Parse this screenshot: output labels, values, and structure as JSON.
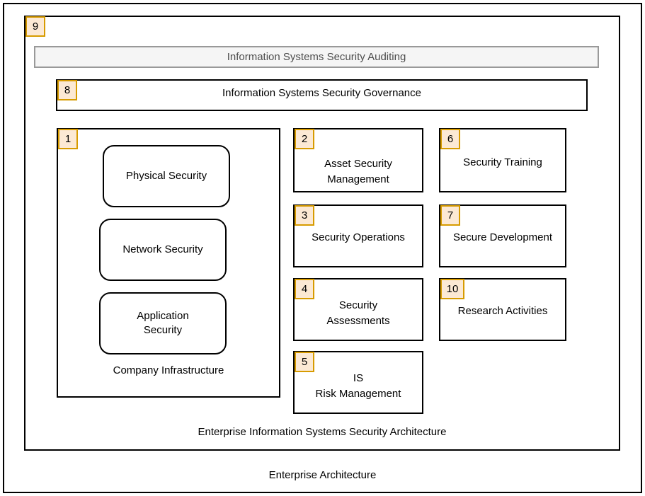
{
  "diagram": {
    "outer_frame": {
      "badge": "9",
      "caption": "Enterprise Architecture"
    },
    "inner_frame": {
      "caption": "Enterprise Information Systems Security Architecture"
    },
    "auditing_banner": {
      "label": "Information Systems Security Auditing",
      "border_color": "#999999",
      "fill_color": "#f5f5f5",
      "text_color": "#4d4d4d"
    },
    "governance": {
      "badge": "8",
      "label": "Information Systems Security Governance"
    },
    "infrastructure": {
      "badge": "1",
      "label": "Company Infrastructure",
      "items": [
        {
          "label": "Physical Security"
        },
        {
          "label": "Network Security"
        },
        {
          "label": "Application\nSecurity",
          "line1": "Application",
          "line2": "Security"
        }
      ]
    },
    "column_middle": [
      {
        "badge": "2",
        "line1": "Asset Security",
        "line2": "Management"
      },
      {
        "badge": "3",
        "line1": "Security Operations",
        "line2": ""
      },
      {
        "badge": "4",
        "line1": "Security",
        "line2": "Assessments"
      },
      {
        "badge": "5",
        "line1": "IS",
        "line2": "Risk Management"
      }
    ],
    "column_right": [
      {
        "badge": "6",
        "line1": "Security Training",
        "line2": ""
      },
      {
        "badge": "7",
        "line1": "Secure Development",
        "line2": ""
      },
      {
        "badge": "10",
        "line1": "Research Activities",
        "line2": ""
      }
    ],
    "colors": {
      "badge_border": "#d79b00",
      "badge_fill": "#fce9d4",
      "box_border": "#000000",
      "background": "#ffffff"
    }
  }
}
